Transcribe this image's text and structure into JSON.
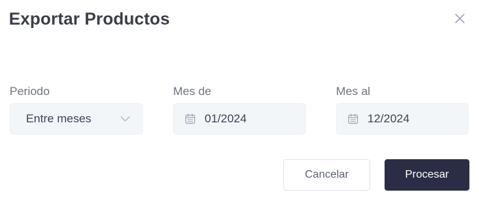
{
  "dialog": {
    "title": "Exportar Productos",
    "close_icon": "close-icon"
  },
  "fields": {
    "period": {
      "label": "Periodo",
      "selected": "Entre meses",
      "icon": "chevron-down-icon"
    },
    "from": {
      "label": "Mes de",
      "value": "01/2024",
      "icon": "calendar-icon"
    },
    "to": {
      "label": "Mes al",
      "value": "12/2024",
      "icon": "calendar-icon"
    }
  },
  "actions": {
    "cancel_label": "Cancelar",
    "process_label": "Procesar"
  },
  "colors": {
    "primary": "#2a2d45",
    "input_bg": "#f3f6f9",
    "label": "#6e7382",
    "text": "#3f4254"
  }
}
